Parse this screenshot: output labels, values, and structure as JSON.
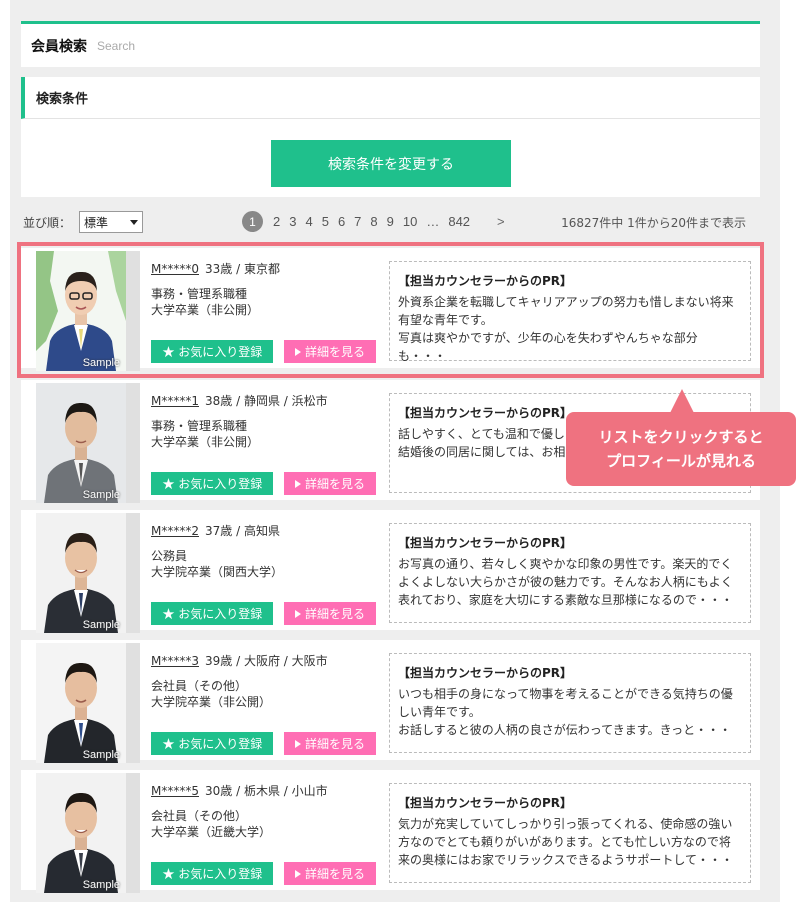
{
  "header": {
    "title": "会員検索",
    "subtitle": "Search"
  },
  "conditions": {
    "heading": "検索条件",
    "change_button": "検索条件を変更する"
  },
  "sort": {
    "label": "並び順：",
    "selected": "標準"
  },
  "pagination": {
    "pages": [
      "1",
      "2",
      "3",
      "4",
      "5",
      "6",
      "7",
      "8",
      "9",
      "10",
      "…",
      "842"
    ],
    "current": "1",
    "next": ">"
  },
  "result_count": "16827件中 1件から20件まで表示",
  "buttons": {
    "favorite": "お気に入り登録",
    "detail": "詳細を見る"
  },
  "sample_label": "Sample",
  "pr_title": "【担当カウンセラーからのPR】",
  "members": [
    {
      "id": "M*****0",
      "detail": "33歳 / 東京都",
      "job": "事務・管理系職種",
      "edu": "大学卒業（非公開）",
      "pr": "外資系企業を転職してキャリアアップの努力も惜しまない将来有望な青年です。\n写真は爽やかですが、少年の心を失わずやんちゃな部分も・・・"
    },
    {
      "id": "M*****1",
      "detail": "38歳 / 静岡県 / 浜松市",
      "job": "事務・管理系職種",
      "edu": "大学卒業（非公開）",
      "pr": "話しやすく、とても温和で優しい\n結婚後の同居に関しては、お相"
    },
    {
      "id": "M*****2",
      "detail": "37歳 / 高知県",
      "job": "公務員",
      "edu": "大学院卒業（関西大学）",
      "pr": "お写真の通り、若々しく爽やかな印象の男性です。楽天的でくよくよしない大らかさが彼の魅力です。そんなお人柄にもよく表れており、家庭を大切にする素敵な旦那様になるので・・・"
    },
    {
      "id": "M*****3",
      "detail": "39歳 / 大阪府 / 大阪市",
      "job": "会社員（その他）",
      "edu": "大学院卒業（非公開）",
      "pr": "いつも相手の身になって物事を考えることができる気持ちの優しい青年です。\nお話しすると彼の人柄の良さが伝わってきます。きっと・・・"
    },
    {
      "id": "M*****5",
      "detail": "30歳 / 栃木県 / 小山市",
      "job": "会社員（その他）",
      "edu": "大学卒業（近畿大学）",
      "pr": "気力が充実していてしっかり引っ張ってくれる、使命感の強い方なのでとても頼りがいがあります。とても忙しい方なので将来の奥様にはお家でリラックスできるようサポートして・・・"
    }
  ],
  "callout": {
    "line1": "リストをクリックすると",
    "line2": "プロフィールが見れる"
  },
  "colors": {
    "accent": "#1fc08c",
    "detail": "#ff6eb4",
    "highlight": "#ef7280"
  }
}
